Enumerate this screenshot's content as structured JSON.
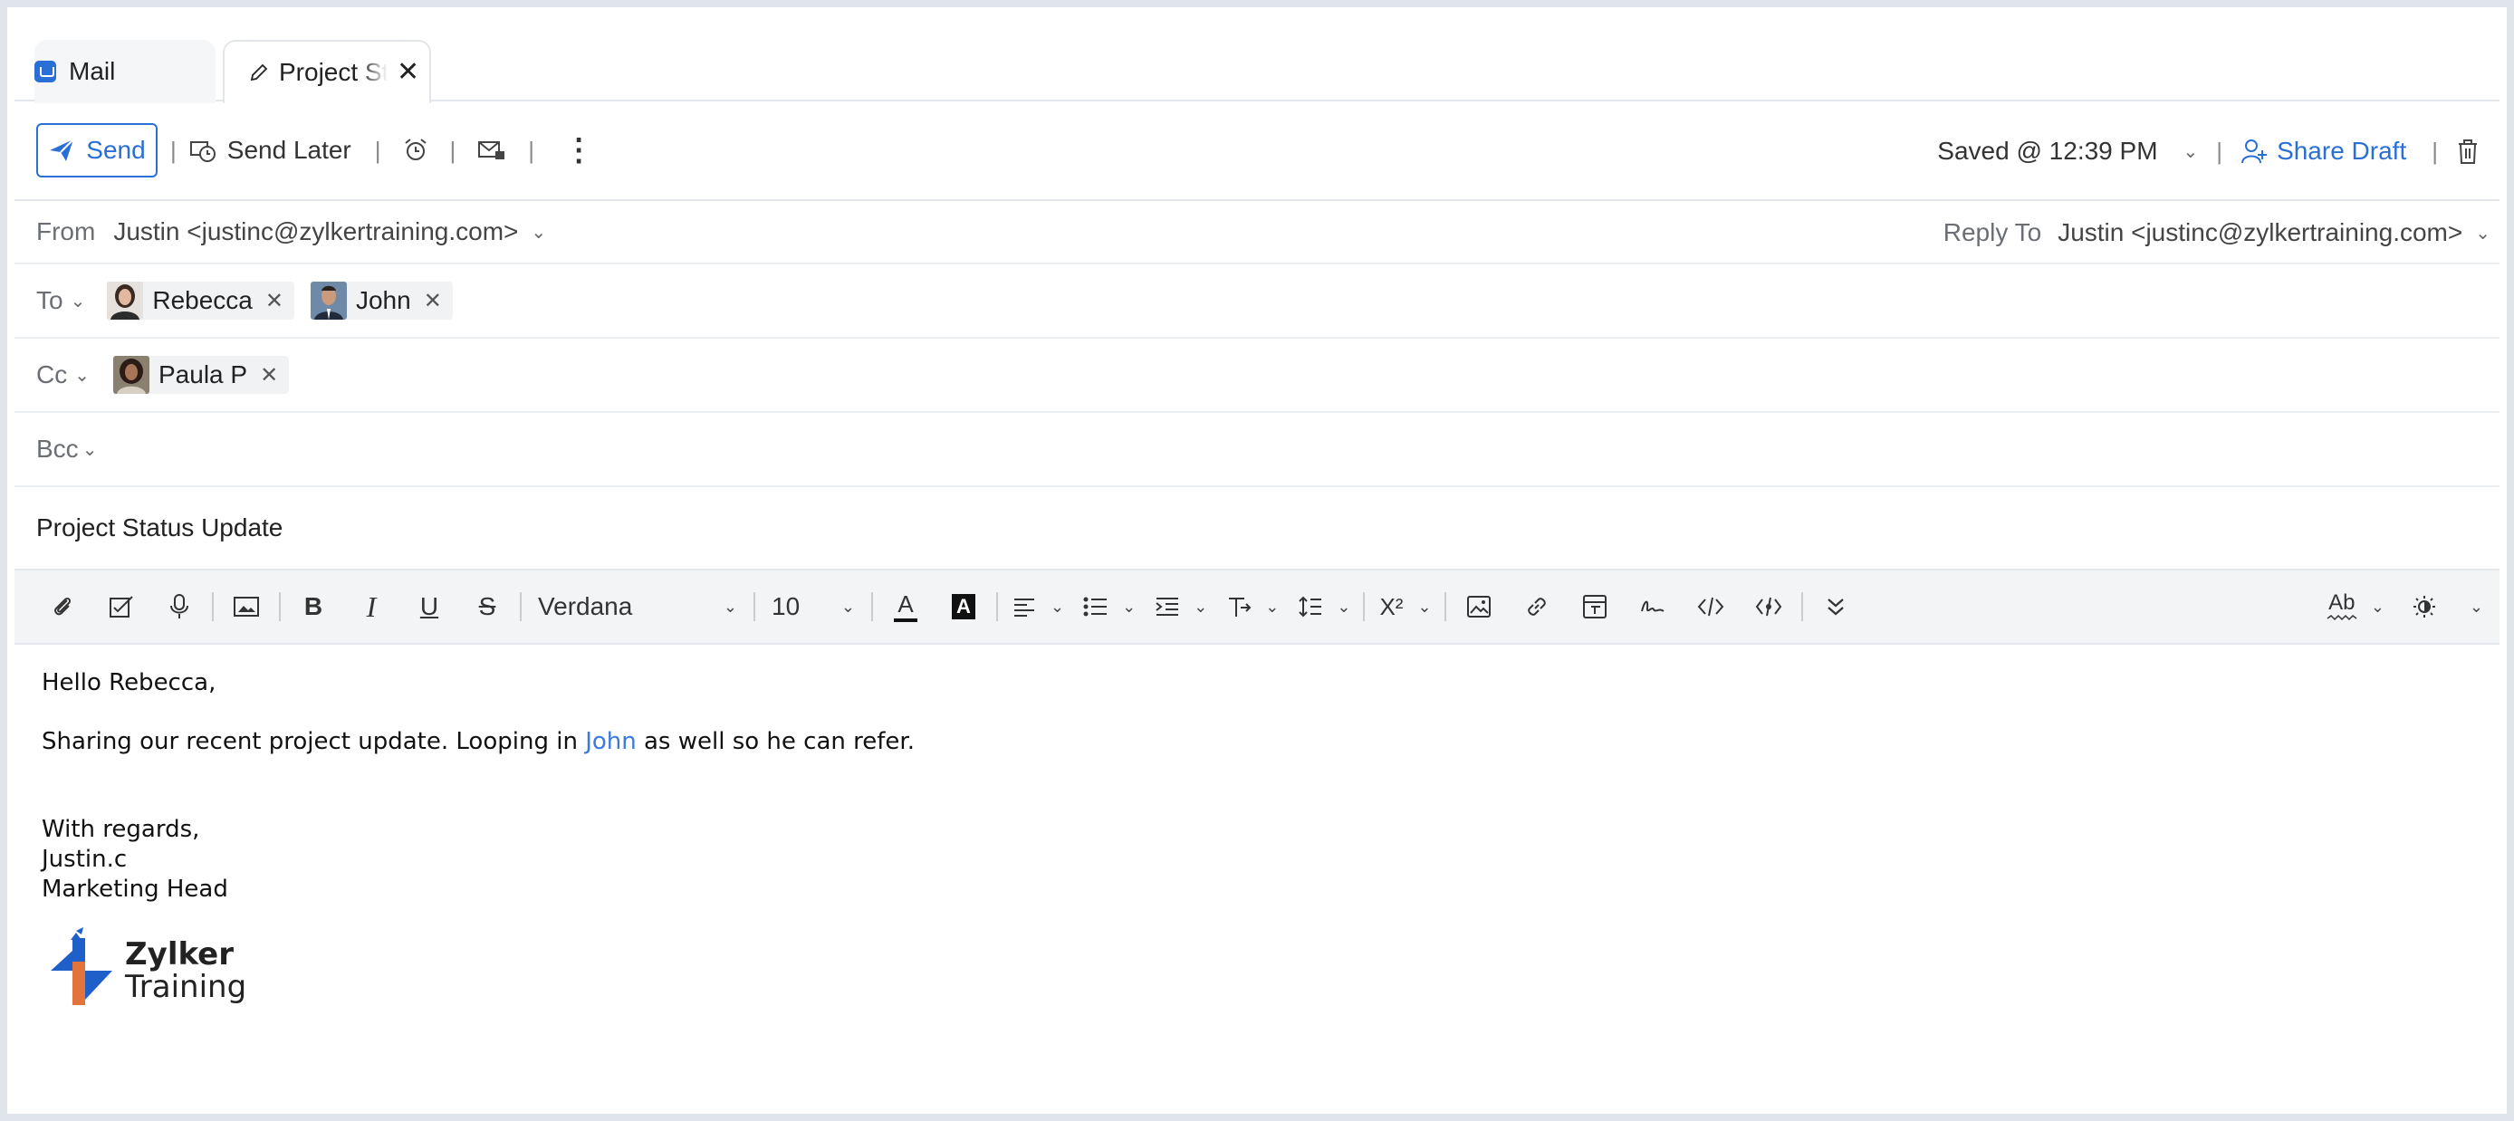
{
  "tabs": [
    {
      "label": "Mail",
      "icon": "mail-icon"
    },
    {
      "label": "Project Status Update",
      "icon": "pencil-icon"
    }
  ],
  "actions": {
    "send_label": "Send",
    "send_later_label": "Send Later",
    "saved_label": "Saved @ 12:39 PM",
    "share_draft_label": "Share Draft"
  },
  "header": {
    "from_label": "From",
    "from_value": "Justin <justinc@zylkertraining.com>",
    "reply_to_label": "Reply To",
    "reply_to_value": "Justin <justinc@zylkertraining.com>",
    "to_label": "To",
    "to": [
      {
        "name": "Rebecca"
      },
      {
        "name": "John"
      }
    ],
    "cc_label": "Cc",
    "cc": [
      {
        "name": "Paula P"
      }
    ],
    "bcc_label": "Bcc",
    "subject": "Project Status Update"
  },
  "format": {
    "font": "Verdana",
    "size": "10"
  },
  "body": {
    "greeting": "Hello Rebecca,",
    "line1_before": "Sharing our recent project update. Looping in ",
    "line1_link": "John",
    "line1_after": " as well so he can refer.",
    "closing": "With regards,",
    "sig_name": "Justin.c",
    "sig_title": "Marketing Head",
    "logo_line1": "Zylker",
    "logo_line2": "Training"
  },
  "colors": {
    "accent": "#2a6fd6",
    "link": "#3b7bd9",
    "logo_blue": "#1f5fc9",
    "logo_orange": "#e2733a"
  }
}
